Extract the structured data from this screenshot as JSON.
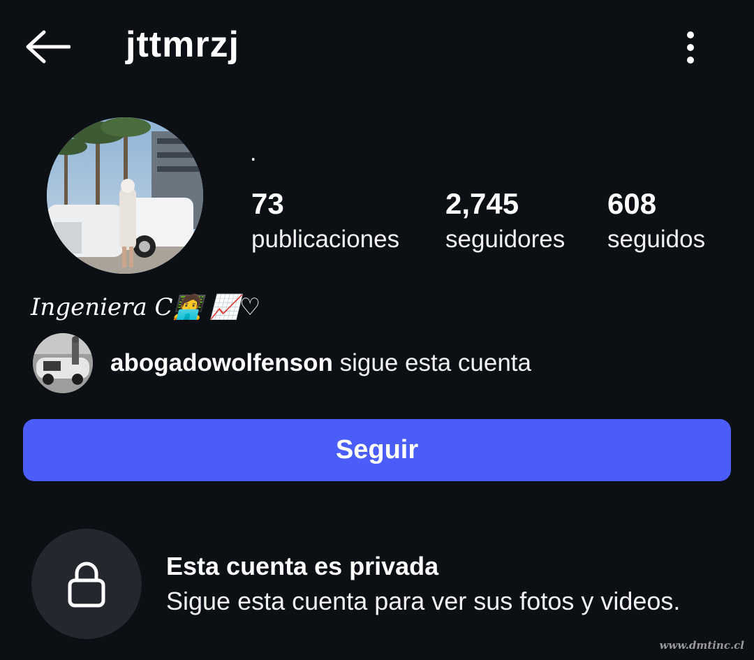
{
  "header": {
    "username": "jttmrzj",
    "back_icon": "arrow-left-icon",
    "more_icon": "more-vertical-icon"
  },
  "profile": {
    "display_name": ".",
    "stats": {
      "posts": {
        "value": "73",
        "label": "publicaciones"
      },
      "followers": {
        "value": "2,745",
        "label": "seguidores"
      },
      "following": {
        "value": "608",
        "label": "seguidos"
      }
    },
    "bio": "Ingeniera C🧑‍💻 📈♡",
    "followed_by": {
      "name": "abogadowolfenson",
      "suffix": " sigue esta cuenta"
    }
  },
  "actions": {
    "follow_label": "Seguir"
  },
  "private_notice": {
    "icon": "lock-icon",
    "title": "Esta cuenta es privada",
    "description": "Sigue esta cuenta para ver sus fotos y videos."
  },
  "watermark": "www.dmtinc.cl",
  "colors": {
    "background": "#0c0f14",
    "accent": "#4a5df9",
    "lock_circle": "#24272d"
  }
}
